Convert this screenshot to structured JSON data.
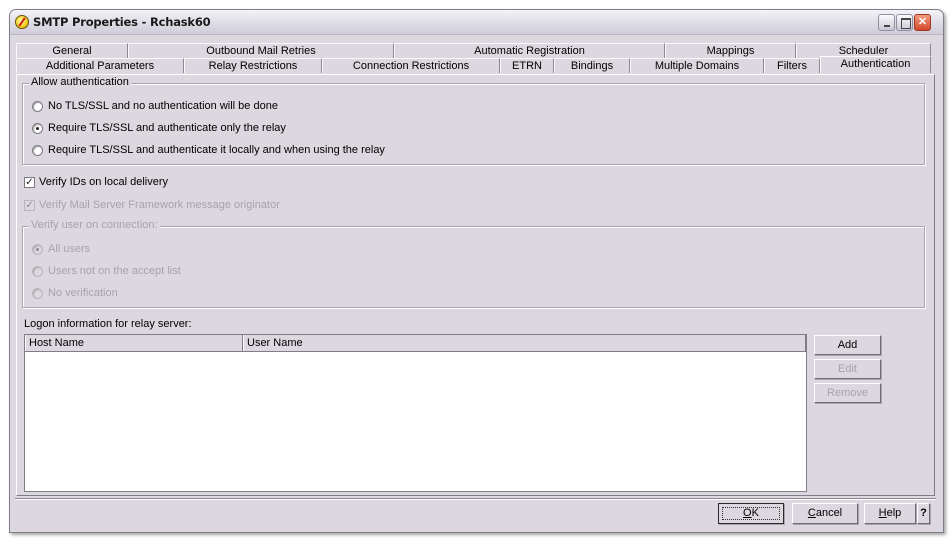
{
  "window": {
    "title": "SMTP Properties - Rchask60",
    "controls": {
      "minimize": "minimize",
      "maximize": "maximize",
      "close": "close"
    }
  },
  "tabs": {
    "row1": [
      {
        "label": "General"
      },
      {
        "label": "Outbound Mail Retries"
      },
      {
        "label": "Automatic Registration"
      },
      {
        "label": "Mappings"
      },
      {
        "label": "Scheduler"
      }
    ],
    "row2": [
      {
        "label": "Additional Parameters"
      },
      {
        "label": "Relay Restrictions"
      },
      {
        "label": "Connection Restrictions"
      },
      {
        "label": "ETRN"
      },
      {
        "label": "Bindings"
      },
      {
        "label": "Multiple Domains"
      },
      {
        "label": "Filters"
      },
      {
        "label": "Authentication",
        "active": true
      }
    ]
  },
  "allow_auth": {
    "title": "Allow authentication",
    "options": [
      {
        "label": "No TLS/SSL and no authentication will be done",
        "checked": false
      },
      {
        "label": "Require TLS/SSL and authenticate only the relay",
        "checked": true
      },
      {
        "label": "Require TLS/SSL and authenticate it locally and when using the relay",
        "checked": false
      }
    ]
  },
  "verify_ids": {
    "label": "Verify IDs on local delivery",
    "checked": true,
    "enabled": true
  },
  "verify_msf": {
    "label": "Verify Mail Server Framework message originator",
    "checked": true,
    "enabled": false
  },
  "verify_user": {
    "title": "Verify user on connection:",
    "enabled": false,
    "options": [
      {
        "label": "All users",
        "checked": true
      },
      {
        "label": "Users not on the accept list",
        "checked": false
      },
      {
        "label": "No verification",
        "checked": false
      }
    ]
  },
  "logon": {
    "label": "Logon information for relay server:",
    "columns": [
      "Host Name",
      "User Name"
    ],
    "rows": [],
    "buttons": {
      "add": "Add",
      "edit": "Edit",
      "remove": "Remove"
    }
  },
  "footer": {
    "ok": {
      "prefix": "",
      "mnemonic": "O",
      "rest": "K"
    },
    "cancel": {
      "prefix": "",
      "mnemonic": "C",
      "rest": "ancel"
    },
    "help": {
      "prefix": "",
      "mnemonic": "H",
      "rest": "elp"
    },
    "whats_this": "?"
  }
}
